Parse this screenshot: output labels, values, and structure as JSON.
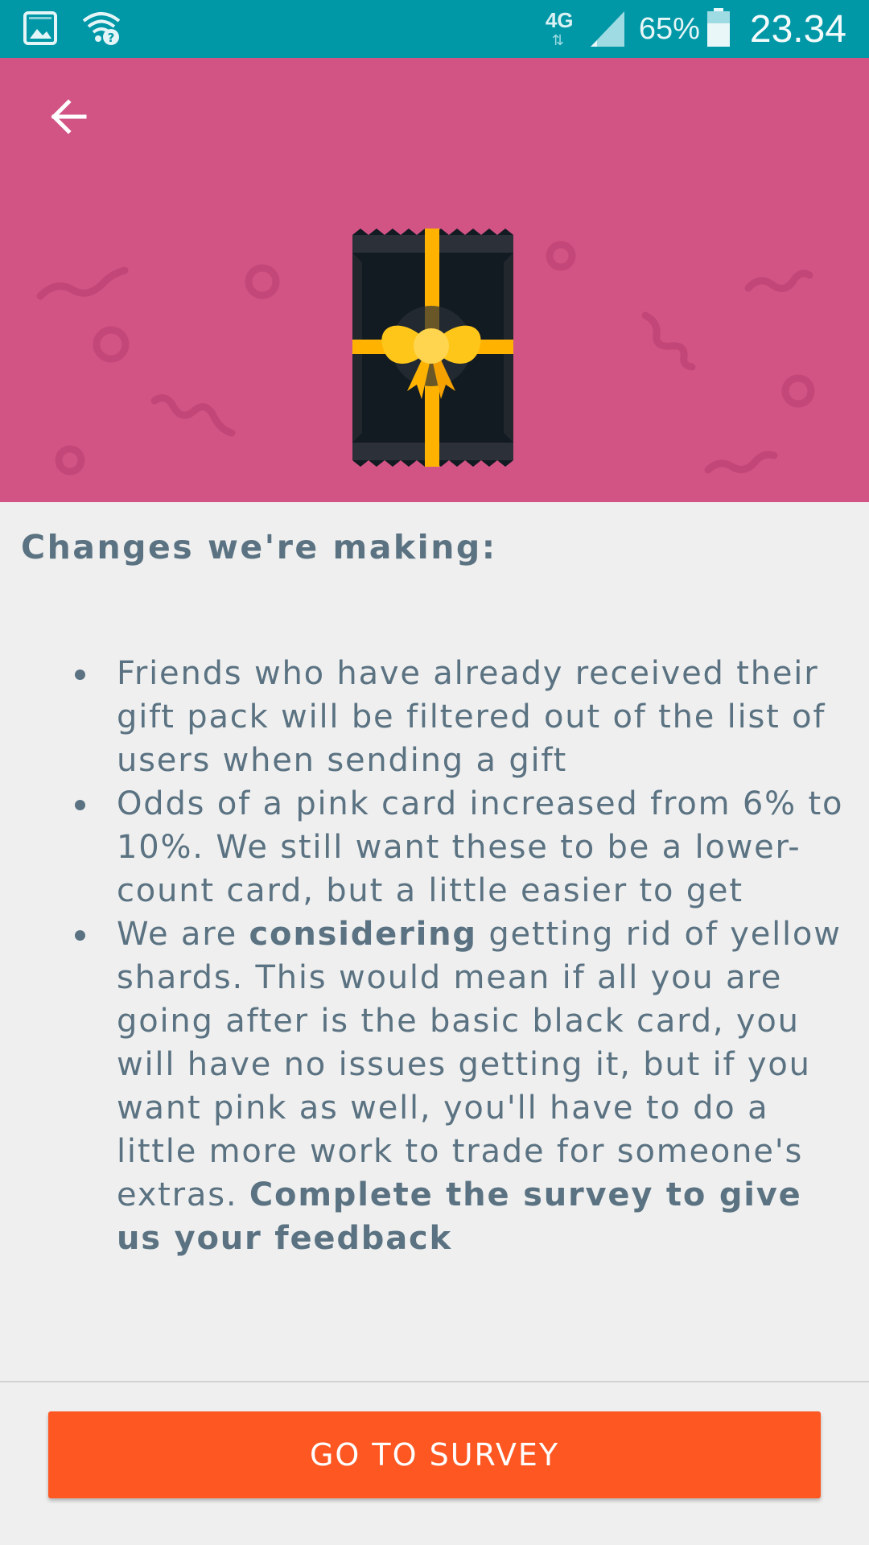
{
  "status_bar": {
    "network_type": "4G",
    "battery_percent": "65%",
    "time": "23.34",
    "icons": [
      "image-notification-icon",
      "wifi-question-icon",
      "cell-signal-icon",
      "battery-icon"
    ]
  },
  "header": {
    "back_icon": "arrow-left-icon",
    "hero_icon": "gift-pack-icon",
    "background_color": "#d25485"
  },
  "content": {
    "title": "Changes we're making:",
    "items": [
      {
        "text": "Friends who have already received their gift pack will be filtered out of the list of users when sending a gift"
      },
      {
        "text": "Odds of a pink card increased from 6% to 10%. We still want these to be a lower-count card, but a little easier to get"
      },
      {
        "part1": "We are ",
        "bold1": "considering",
        "part2": " getting rid of yellow shards. This would mean if all you are going after is the basic black card, you will have no issues getting it, but if you want pink as well, you'll have to do a little more work to trade for someone's extras. ",
        "bold2": "Complete the survey to give us your feedback"
      }
    ]
  },
  "footer": {
    "button_label": "GO TO SURVEY",
    "button_color": "#ff5722"
  }
}
